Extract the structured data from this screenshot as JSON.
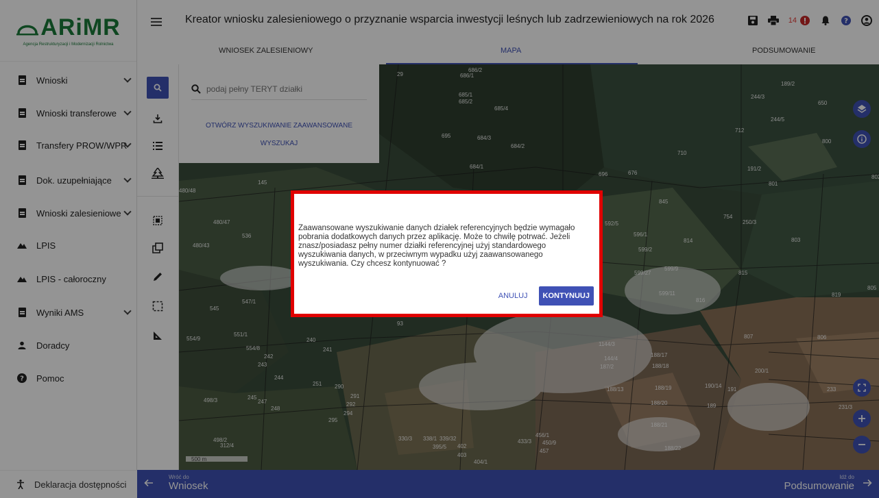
{
  "app": {
    "logo_text": "ARiMR",
    "logo_subtitle": "Agencja Restrukturyzacji i Modernizacji Rolnictwa",
    "title": "Kreator wniosku zalesieniowego o przyznanie wsparcia inwestycji leśnych lub zadrzewieniowych na rok 2026",
    "notification_count": "14"
  },
  "sidebar": {
    "items": [
      {
        "label": "Wnioski",
        "icon": "clipboard-icon",
        "expandable": true
      },
      {
        "label": "Wnioski transferowe",
        "icon": "clipboard-icon",
        "expandable": true
      },
      {
        "label": "Transfery PROW/WPR",
        "icon": "clipboard-icon",
        "expandable": true
      },
      {
        "label": "Dok. uzupełniające",
        "icon": "clipboard-icon",
        "expandable": true
      },
      {
        "label": "Wnioski zalesieniowe",
        "icon": "clipboard-icon",
        "expandable": true
      },
      {
        "label": "LPIS",
        "icon": "terrain-icon",
        "expandable": false
      },
      {
        "label": "LPIS - całoroczny",
        "icon": "terrain-icon",
        "expandable": false
      },
      {
        "label": "Wyniki AMS",
        "icon": "clipboard-icon",
        "expandable": true
      },
      {
        "label": "Doradcy",
        "icon": "person-icon",
        "expandable": false
      },
      {
        "label": "Pomoc",
        "icon": "help-icon",
        "expandable": false
      }
    ],
    "footer_label": "Deklaracja dostępności"
  },
  "tabs": [
    {
      "label": "WNIOSEK ZALESIENIOWY"
    },
    {
      "label": "MAPA",
      "active": true
    },
    {
      "label": "PODSUMOWANIE"
    }
  ],
  "search": {
    "placeholder": "podaj pełny TERYT działki",
    "advanced_label": "OTWÓRZ WYSZUKIWANIE ZAAWANSOWANE",
    "search_label": "WYSZUKAJ"
  },
  "map": {
    "scale_label": "500 m",
    "parcel_labels": [
      "686/2",
      "686/1",
      "685/1",
      "685/2",
      "685/4",
      "684/3",
      "684/2",
      "684/1",
      "695",
      "696",
      "676",
      "710",
      "712",
      "244/3",
      "244/5",
      "189/2",
      "650",
      "800",
      "191/2",
      "801",
      "802",
      "845",
      "754",
      "250/3",
      "803",
      "814",
      "592/5",
      "596/1",
      "599/2",
      "599/27",
      "599/9",
      "599/11",
      "815",
      "816",
      "805",
      "819",
      "807",
      "806",
      "188/17",
      "188/18",
      "188/19",
      "190/14",
      "191",
      "200/1",
      "188/13",
      "188/20",
      "188/21",
      "188/22",
      "189",
      "231/3",
      "233",
      "480/48",
      "480/47",
      "480/43",
      "536",
      "545",
      "547/1",
      "554/9",
      "551/1",
      "554/8",
      "240",
      "241",
      "242",
      "243",
      "244",
      "245",
      "251",
      "290",
      "291",
      "292",
      "294",
      "295",
      "330/3",
      "338/1",
      "339/32",
      "395/5",
      "402",
      "403",
      "404/1",
      "433/3",
      "450/9",
      "456/1",
      "457",
      "498/3",
      "498/2",
      "312/4",
      "247",
      "248",
      "1144/3",
      "144/4",
      "187/2",
      "29",
      "41",
      "145",
      "93"
    ]
  },
  "dialog": {
    "message": "Zaawansowane wyszukiwanie danych działek referencyjnych będzie wymagało pobrania dodatkowych danych przez aplikację. Może to chwilę potrwać. Jeżeli znasz/posiadasz pełny numer działki referencyjnej użyj standardowego wyszukiwania danych, w przeciwnym wypadku użyj zaawansowanego wyszukiwania. Czy chcesz kontynuować ?",
    "cancel_label": "ANULUJ",
    "confirm_label": "KONTYNUUJ"
  },
  "footer": {
    "back_small": "Wróć do",
    "back_big": "Wniosek",
    "forward_small": "Idź do",
    "forward_big": "Podsumowanie"
  },
  "colors": {
    "primary": "#3f51b5",
    "highlight_border": "#e00000",
    "brand_green": "#1a7a3a"
  }
}
